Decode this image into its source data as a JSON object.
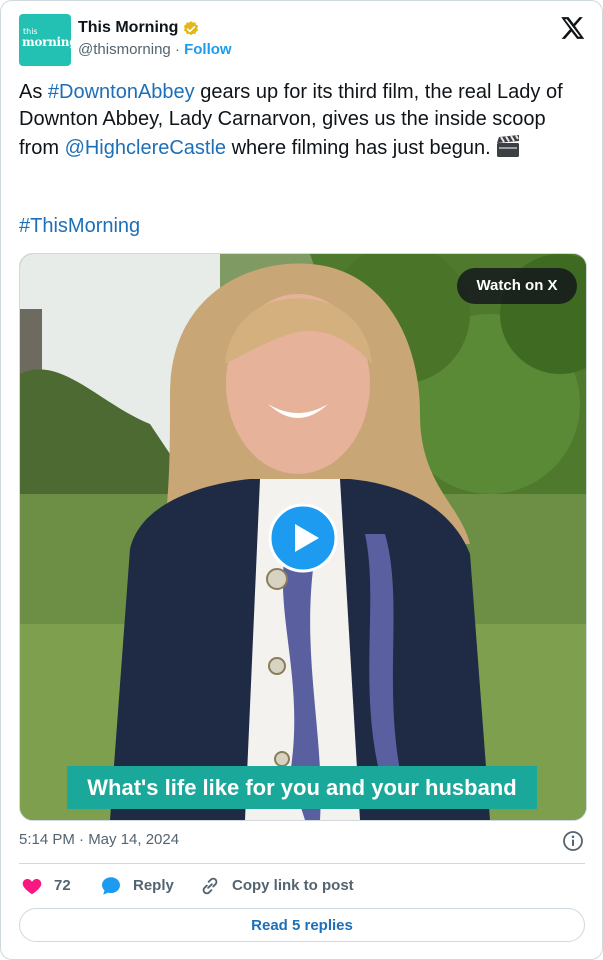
{
  "author": {
    "avatar_line1": "this",
    "avatar_line2": "morning",
    "name": "This Morning",
    "handle": "@thismorning",
    "separator": "·",
    "follow_label": "Follow"
  },
  "post": {
    "text_part1": "As ",
    "hashtag1": "#DowntonAbbey",
    "text_part2": " gears up for its third film, the real Lady of Downton Abbey, Lady Carnarvon, gives us the inside scoop from ",
    "mention": "@HighclereCastle",
    "text_part3": " where filming has just begun.",
    "emoji_icon": "clapper-board-icon",
    "hashtag2": "#ThisMorning"
  },
  "media": {
    "watch_label": "Watch on X",
    "caption": "What's life like for you and your husband",
    "caption_color": "#1aa89a"
  },
  "meta": {
    "timestamp": "5:14 PM · May 14, 2024"
  },
  "actions": {
    "like_count": "72",
    "reply_label": "Reply",
    "copy_label": "Copy link to post",
    "read_replies_label": "Read 5 replies"
  },
  "colors": {
    "accent": "#1d9bf0",
    "link": "#1d6fb8",
    "like": "#f91880",
    "muted": "#536471",
    "brand_teal": "#23c1b4"
  }
}
